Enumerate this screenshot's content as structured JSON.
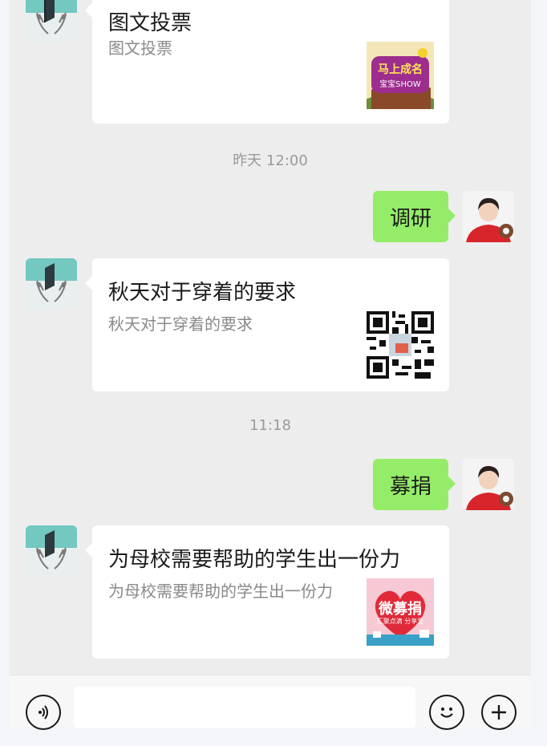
{
  "messages": [
    {
      "type": "card",
      "sender": "bot",
      "title": "图文投票",
      "description": "图文投票",
      "thumbnail": {
        "icon": "baby-show-poster",
        "lines": [
          "马上成名",
          "宝宝SHOW"
        ]
      }
    },
    {
      "type": "time",
      "text": "昨天 12:00"
    },
    {
      "type": "text",
      "sender": "user",
      "text": "调研"
    },
    {
      "type": "card",
      "sender": "bot",
      "title": "秋天对于穿着的要求",
      "description": "秋天对于穿着的要求",
      "thumbnail": {
        "icon": "qr-code"
      }
    },
    {
      "type": "time",
      "text": "11:18"
    },
    {
      "type": "text",
      "sender": "user",
      "text": "募捐"
    },
    {
      "type": "card",
      "sender": "bot",
      "title": "为母校需要帮助的学生出一份力",
      "description": "为母校需要帮助的学生出一份力",
      "thumbnail": {
        "icon": "donation-poster",
        "lines": [
          "微募捐",
          "汇聚点滴 分享爱"
        ]
      }
    }
  ],
  "input_bar": {
    "placeholder": "",
    "icons": [
      "voice-icon",
      "emoji-icon",
      "plus-icon"
    ]
  },
  "colors": {
    "chat_bg": "#ededed",
    "bubble_green": "#95ec69",
    "bot_avatar_teal": "#73c8c0",
    "card_bg": "#ffffff"
  }
}
